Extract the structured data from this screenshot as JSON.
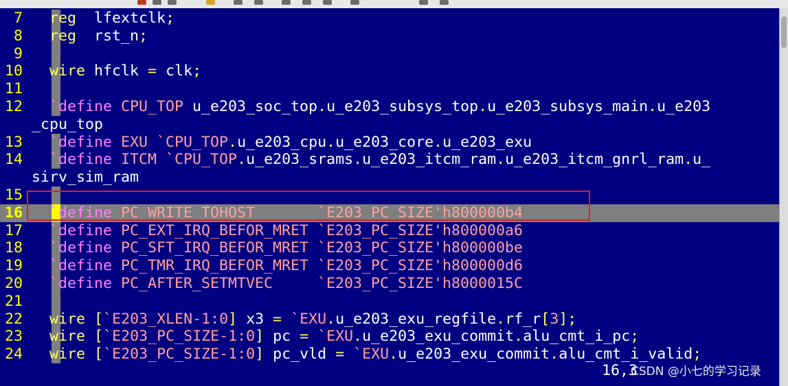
{
  "lines": [
    {
      "n": "7",
      "segs": [
        [
          "kw",
          "reg"
        ],
        [
          "",
          "  lfextclk"
        ],
        [
          "op",
          ";"
        ]
      ]
    },
    {
      "n": "8",
      "segs": [
        [
          "kw",
          "reg"
        ],
        [
          "",
          "  rst_n"
        ],
        [
          "op",
          ";"
        ]
      ]
    },
    {
      "n": "9",
      "segs": []
    },
    {
      "n": "10",
      "segs": [
        [
          "kw",
          "wire"
        ],
        [
          "",
          " hfclk "
        ],
        [
          "op",
          "="
        ],
        [
          "",
          " clk"
        ],
        [
          "op",
          ";"
        ]
      ]
    },
    {
      "n": "11",
      "segs": []
    },
    {
      "n": "12",
      "segs": [
        [
          "pp",
          "`define"
        ],
        [
          "sym",
          " CPU_TOP"
        ],
        [
          "",
          " u_e203_soc_top"
        ],
        [
          "op",
          "."
        ],
        [
          "",
          "u_e203_subsys_top"
        ],
        [
          "op",
          "."
        ],
        [
          "",
          "u_e203_subsys_main"
        ],
        [
          "op",
          "."
        ],
        [
          "",
          "u_e203"
        ]
      ]
    },
    {
      "n": "",
      "segs": [
        [
          "",
          "_cpu_top"
        ]
      ],
      "wrap": true
    },
    {
      "n": "13",
      "segs": [
        [
          "pp",
          "`define"
        ],
        [
          "sym",
          " EXU"
        ],
        [
          "sym",
          " `CPU_TOP"
        ],
        [
          "op",
          "."
        ],
        [
          "",
          "u_e203_cpu"
        ],
        [
          "op",
          "."
        ],
        [
          "",
          "u_e203_core"
        ],
        [
          "op",
          "."
        ],
        [
          "",
          "u_e203_exu"
        ]
      ]
    },
    {
      "n": "14",
      "segs": [
        [
          "pp",
          "`define"
        ],
        [
          "sym",
          " ITCM"
        ],
        [
          "sym",
          " `CPU_TOP"
        ],
        [
          "op",
          "."
        ],
        [
          "",
          "u_e203_srams"
        ],
        [
          "op",
          "."
        ],
        [
          "",
          "u_e203_itcm_ram"
        ],
        [
          "op",
          "."
        ],
        [
          "",
          "u_e203_itcm_gnrl_ram"
        ],
        [
          "op",
          "."
        ],
        [
          "",
          "u_"
        ]
      ]
    },
    {
      "n": "",
      "segs": [
        [
          "",
          "sirv_sim_ram"
        ]
      ],
      "wrap": true
    },
    {
      "n": "15",
      "segs": []
    },
    {
      "n": "16",
      "segs": [
        [
          "pp",
          "`define"
        ],
        [
          "sym",
          " PC_WRITE_TOHOST       `E203_PC_SIZE'h800000b4"
        ]
      ],
      "current": true
    },
    {
      "n": "17",
      "segs": [
        [
          "pp",
          "`define"
        ],
        [
          "sym",
          " PC_EXT_IRQ_BEFOR_MRET `E203_PC_SIZE'h800000a6"
        ]
      ]
    },
    {
      "n": "18",
      "segs": [
        [
          "pp",
          "`define"
        ],
        [
          "sym",
          " PC_SFT_IRQ_BEFOR_MRET `E203_PC_SIZE'h800000be"
        ]
      ]
    },
    {
      "n": "19",
      "segs": [
        [
          "pp",
          "`define"
        ],
        [
          "sym",
          " PC_TMR_IRQ_BEFOR_MRET `E203_PC_SIZE'h800000d6"
        ]
      ]
    },
    {
      "n": "20",
      "segs": [
        [
          "pp",
          "`define"
        ],
        [
          "sym",
          " PC_AFTER_SETMTVEC     `E203_PC_SIZE'h8000015C"
        ]
      ]
    },
    {
      "n": "21",
      "segs": []
    },
    {
      "n": "22",
      "segs": [
        [
          "kw",
          "wire"
        ],
        [
          "",
          " "
        ],
        [
          "op",
          "["
        ],
        [
          "sym",
          "`E203_XLEN-1:0"
        ],
        [
          "op",
          "]"
        ],
        [
          "",
          " x3 "
        ],
        [
          "op",
          "="
        ],
        [
          "sym",
          " `EXU"
        ],
        [
          "op",
          "."
        ],
        [
          "",
          "u_e203_exu_regfile"
        ],
        [
          "op",
          "."
        ],
        [
          "",
          "rf_r"
        ],
        [
          "op",
          "["
        ],
        [
          "sym",
          "3"
        ],
        [
          "op",
          "];"
        ]
      ]
    },
    {
      "n": "23",
      "segs": [
        [
          "kw",
          "wire"
        ],
        [
          "",
          " "
        ],
        [
          "op",
          "["
        ],
        [
          "sym",
          "`E203_PC_SIZE-1:0"
        ],
        [
          "op",
          "]"
        ],
        [
          "",
          " pc "
        ],
        [
          "op",
          "="
        ],
        [
          "sym",
          " `EXU"
        ],
        [
          "op",
          "."
        ],
        [
          "",
          "u_e203_exu_commit"
        ],
        [
          "op",
          "."
        ],
        [
          "",
          "alu_cmt_i_pc"
        ],
        [
          "op",
          ";"
        ]
      ]
    },
    {
      "n": "24",
      "segs": [
        [
          "kw",
          "wire"
        ],
        [
          "",
          " "
        ],
        [
          "op",
          "["
        ],
        [
          "sym",
          "`E203_PC_SIZE-1:0"
        ],
        [
          "op",
          "]"
        ],
        [
          "",
          " pc_vld "
        ],
        [
          "op",
          "="
        ],
        [
          "sym",
          " `EXU"
        ],
        [
          "op",
          "."
        ],
        [
          "",
          "u_e203_exu_commit"
        ],
        [
          "op",
          "."
        ],
        [
          "",
          "alu_cmt_i_valid"
        ],
        [
          "op",
          ";"
        ]
      ]
    }
  ],
  "status": {
    "cursor_position": "16,3",
    "watermark": "CSDN @小七的学习记录"
  },
  "colors": {
    "background": "#000080",
    "line_number": "#ffff00",
    "keyword": "#ffff60",
    "preproc": "#ff80ff",
    "symbol": "#ffa0a0",
    "current_line": "#7f7f7f"
  }
}
